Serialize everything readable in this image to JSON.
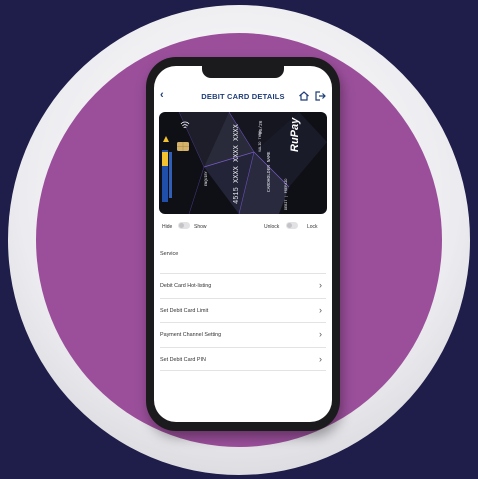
{
  "header": {
    "back_glyph": "‹",
    "title": "DEBIT CARD DETAILS",
    "icons": [
      "home-icon",
      "logout-icon"
    ]
  },
  "card": {
    "brand": "RuPay",
    "number": "4515 XXXX XXXX XXXX",
    "holder": "CARDHOLDER NAME",
    "valid_label": "VALID THRU",
    "valid": "05/26",
    "type_label": "DEBIT | PREPAID",
    "small_label": "ENQUIRY"
  },
  "toggles": {
    "hide_label": "Hide",
    "show_label": "Show",
    "unlock_label": "Unlock",
    "lock_label": "Lock"
  },
  "section_title": "Service",
  "services": [
    {
      "label": "Debit Card Hot-listing"
    },
    {
      "label": "Set Debit Card Limit"
    },
    {
      "label": "Payment Channel Setting"
    },
    {
      "label": "Set Debit Card PIN"
    }
  ],
  "colors": {
    "background": "#1f1d4a",
    "disc": "#9b4f9b",
    "accent": "#1f3c78"
  }
}
